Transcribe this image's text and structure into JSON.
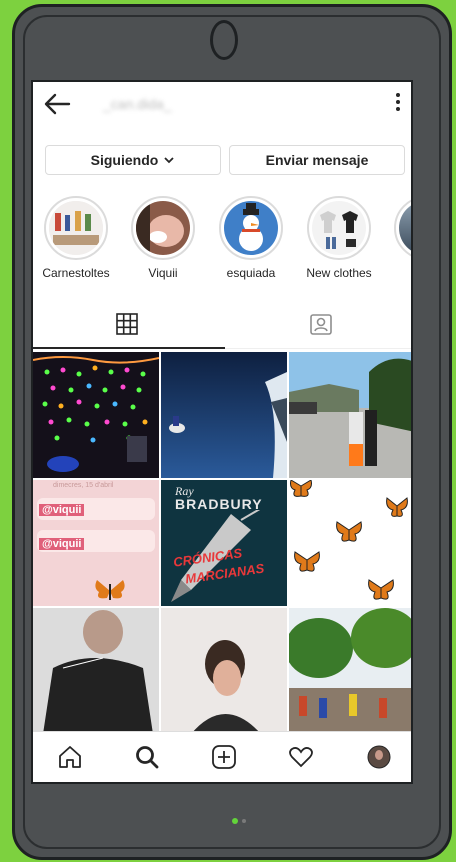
{
  "header": {
    "username": "_can.dida_"
  },
  "actions": {
    "following_label": "Siguiendo",
    "message_label": "Enviar mensaje"
  },
  "stories": [
    {
      "label": "Carnestoltes"
    },
    {
      "label": "Viquii"
    },
    {
      "label": "esquiada"
    },
    {
      "label": "New clothes"
    },
    {
      "label": ""
    }
  ],
  "posts": {
    "story1_date": "dimecres, 15 d'abril",
    "story1_tag": "@viquii",
    "story1_tag2": "@viquii",
    "book_author_1": "Ray",
    "book_author_2": "BRADBURY",
    "book_title_1": "CRÓNICAS",
    "book_title_2": "MARCIANAS"
  },
  "tabs": [
    "grid-icon",
    "tagged-icon"
  ],
  "bottom_nav": [
    "home-icon",
    "search-icon",
    "add-icon",
    "heart-icon",
    "profile-avatar"
  ],
  "colors": {
    "background": "#7dd13f",
    "phone": "#4d5052",
    "text": "#262626",
    "border": "#dbdbdb"
  }
}
